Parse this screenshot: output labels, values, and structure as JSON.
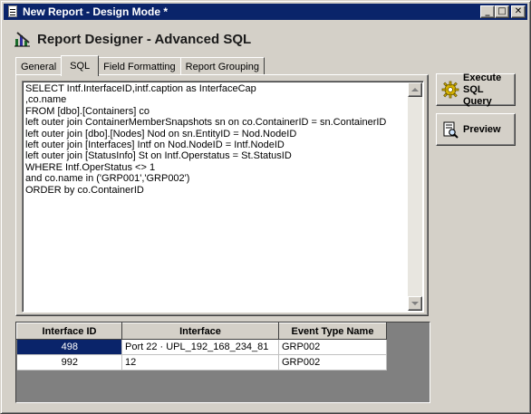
{
  "window": {
    "title": "New Report - Design Mode *",
    "controls": {
      "minimize": "_",
      "maximize": "□",
      "close": "✕"
    }
  },
  "header": {
    "title": "Report Designer - Advanced SQL",
    "icon": "designer-icon"
  },
  "tabs": [
    {
      "label": "General",
      "active": false
    },
    {
      "label": "SQL",
      "active": true
    },
    {
      "label": "Field Formatting",
      "active": false
    },
    {
      "label": "Report Grouping",
      "active": false
    }
  ],
  "sql": {
    "text": "SELECT Intf.InterfaceID,intf.caption as InterfaceCap\n,co.name\nFROM [dbo].[Containers] co\nleft outer join ContainerMemberSnapshots sn on co.ContainerID = sn.ContainerID\nleft outer join [dbo].[Nodes] Nod on sn.EntityID = Nod.NodeID\nleft outer join [Interfaces] Intf on Nod.NodeID = Intf.NodeID\nleft outer join [StatusInfo] St on Intf.Operstatus = St.StatusID\nWHERE Intf.OperStatus <> 1\nand co.name in ('GRP001','GRP002')\nORDER by co.ContainerID"
  },
  "buttons": {
    "execute": {
      "label_line1": "Execute",
      "label_line2": "SQL Query",
      "icon": "gear-icon"
    },
    "preview": {
      "label": "Preview",
      "icon": "preview-icon"
    }
  },
  "grid": {
    "columns": [
      "Interface ID",
      "Interface",
      "Event Type Name"
    ],
    "rows": [
      {
        "id": "498",
        "interface": "Port 22 · UPL_192_168_234_81",
        "event_type": "GRP002",
        "selected": true
      },
      {
        "id": "992",
        "interface": "12",
        "event_type": "GRP002",
        "selected": false
      }
    ]
  },
  "colors": {
    "titlebar": "#0a246a",
    "face": "#d4d0c8",
    "selection": "#0a246a"
  }
}
